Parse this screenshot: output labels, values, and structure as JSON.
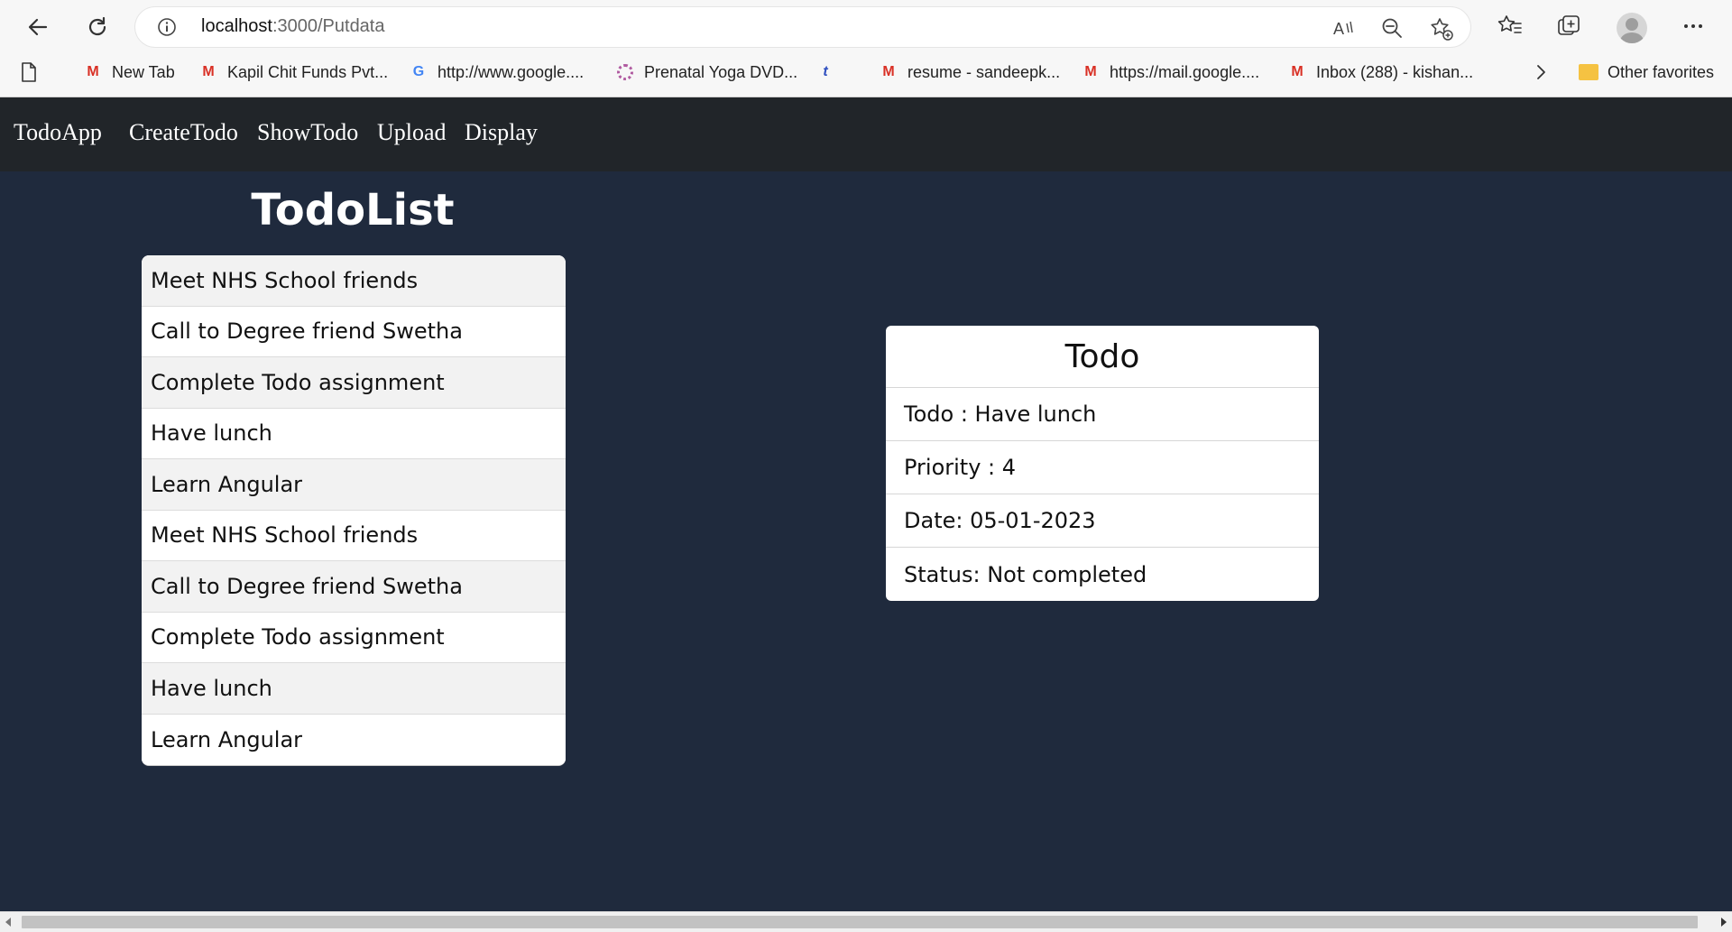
{
  "browser": {
    "url_host": "localhost",
    "url_path": ":3000/Putdata",
    "icons": [
      "back-icon",
      "refresh-icon",
      "info-icon",
      "read-aloud-icon",
      "zoom-out-icon",
      "add-favorite-icon",
      "favorites-icon",
      "collections-icon",
      "profile-avatar",
      "more-icon"
    ],
    "bookmarks": [
      {
        "label": "New Tab",
        "icon": "page-icon"
      },
      {
        "label": "Kapil Chit Funds Pvt...",
        "icon": "gmail-icon"
      },
      {
        "label": "http://www.google....",
        "icon": "google-icon"
      },
      {
        "label": "Prenatal Yoga DVD...",
        "icon": "yoga-icon"
      },
      {
        "label": "",
        "icon": "tumblr-icon"
      },
      {
        "label": "resume - sandeepk...",
        "icon": "gmail-icon"
      },
      {
        "label": "https://mail.google....",
        "icon": "gmail-icon"
      },
      {
        "label": "Inbox (288) - kishan...",
        "icon": "gmail-icon"
      }
    ],
    "other_favorites": "Other favorites"
  },
  "navbar": {
    "brand": "TodoApp",
    "links": [
      "CreateTodo",
      "ShowTodo",
      "Upload",
      "Display"
    ]
  },
  "todo_list": {
    "title": "TodoList",
    "items": [
      "Meet NHS School friends",
      "Call to Degree friend Swetha",
      "Complete Todo assignment",
      "Have lunch",
      "Learn Angular",
      "Meet NHS School friends",
      "Call to Degree friend Swetha",
      "Complete Todo assignment",
      "Have lunch",
      "Learn Angular"
    ]
  },
  "todo_detail": {
    "title": "Todo",
    "todo": "Todo : Have lunch",
    "priority": "Priority : 4",
    "date": "Date: 05-01-2023",
    "status": "Status: Not completed"
  },
  "colors": {
    "page_bg": "#1f2a3d",
    "navbar_bg": "#212529"
  }
}
